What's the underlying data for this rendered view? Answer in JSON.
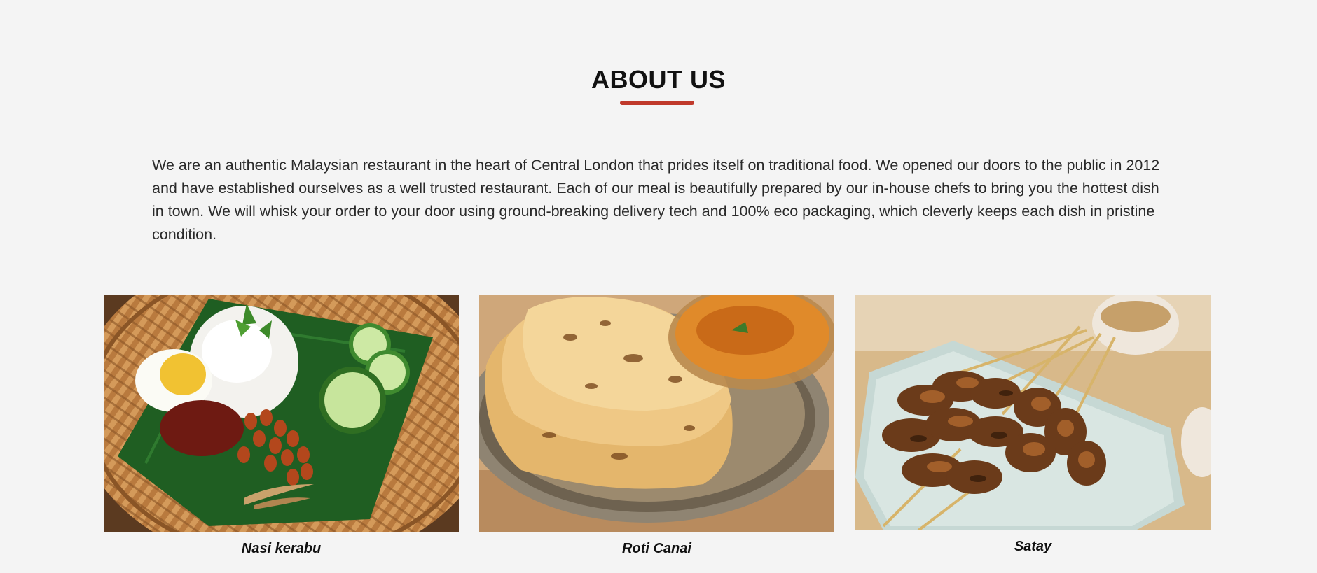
{
  "about": {
    "title": "ABOUT US",
    "accent_color": "#c0392b",
    "description": "We are an authentic Malaysian restaurant in the heart of Central London that prides itself on traditional food. We opened our doors to the public in 2012 and have established ourselves as a well trusted restaurant. Each of our meal is beautifully prepared by our in-house chefs to bring you the hottest dish in town. We will whisk your order to your door using ground-breaking delivery tech and 100% eco packaging, which cleverly keeps each dish in pristine condition."
  },
  "dishes": [
    {
      "name": "Nasi kerabu",
      "image": "nasi-kerabu-photo"
    },
    {
      "name": "Roti Canai",
      "image": "roti-canai-photo"
    },
    {
      "name": "Satay",
      "image": "satay-photo"
    }
  ]
}
